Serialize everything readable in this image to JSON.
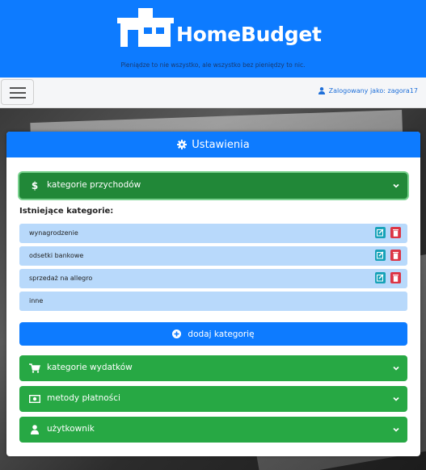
{
  "header": {
    "brand": "HomeBudget",
    "tagline": "Pieniądze to nie wszystko, ale wszystko bez pieniędzy to nic."
  },
  "navbar": {
    "user_text": "Zalogowany jako: zagora17"
  },
  "card": {
    "title": "Ustawienia",
    "income_section": "kategorie przychodów",
    "existing_label": "Istniejące kategorie:",
    "categories": [
      {
        "name": "wynagrodzenie"
      },
      {
        "name": "odsetki bankowe"
      },
      {
        "name": "sprzedaż na allegro"
      },
      {
        "name": "inne"
      }
    ],
    "add_button": "dodaj kategorię",
    "sections": [
      {
        "label": "kategorie wydatków",
        "icon": "cart-icon"
      },
      {
        "label": "metody płatności",
        "icon": "money-bill-icon"
      },
      {
        "label": "użytkownik",
        "icon": "user-icon"
      }
    ]
  },
  "colors": {
    "primary": "#0d7bff",
    "success": "#27a844",
    "info": "#17a2b8",
    "danger": "#dc3545",
    "category_bg": "#b8d9fb"
  }
}
